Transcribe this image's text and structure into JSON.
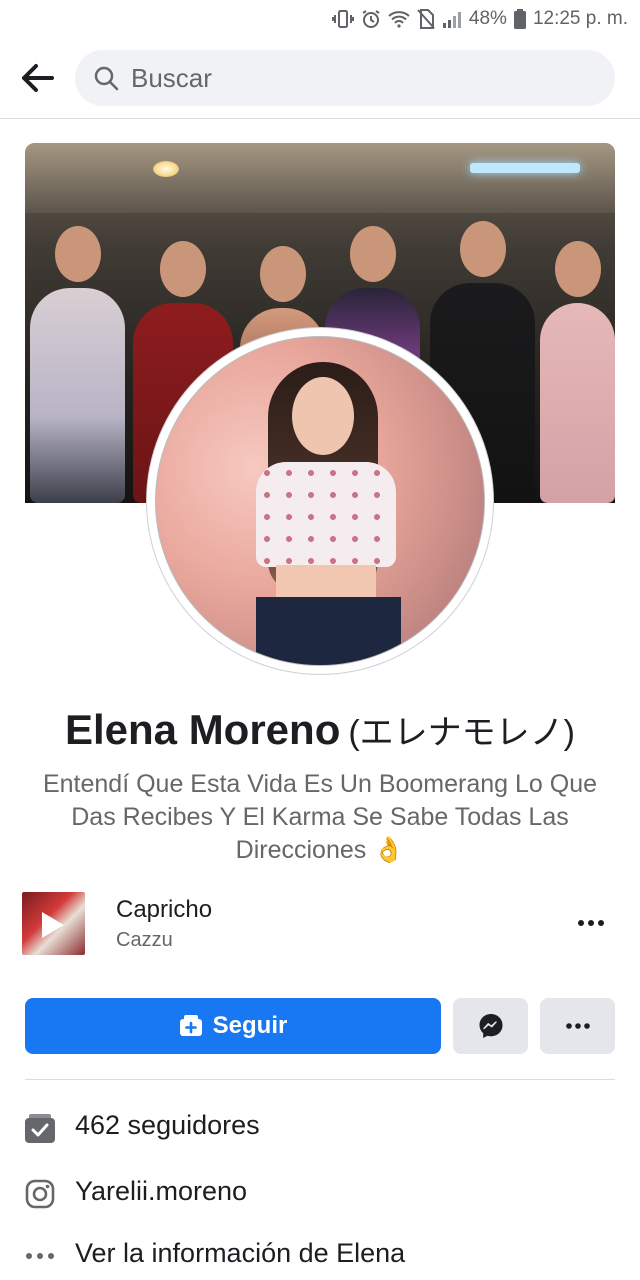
{
  "status_bar": {
    "battery": "48%",
    "time": "12:25 p. m."
  },
  "search": {
    "placeholder": "Buscar"
  },
  "profile": {
    "name": "Elena Moreno",
    "alt_name": "(エレナモレノ)",
    "bio": "Entendí Que Esta Vida Es Un Boomerang Lo Que Das Recibes Y El Karma Se Sabe Todas Las Direcciones 👌"
  },
  "music": {
    "title": "Capricho",
    "artist": "Cazzu"
  },
  "actions": {
    "follow_label": "Seguir"
  },
  "info": {
    "followers": "462 seguidores",
    "instagram": "Yarelii.moreno",
    "see_info": "Ver la información de Elena"
  },
  "colors": {
    "accent": "#1877f2",
    "secondary_button": "#e4e6eb",
    "text_secondary": "#65676b"
  }
}
